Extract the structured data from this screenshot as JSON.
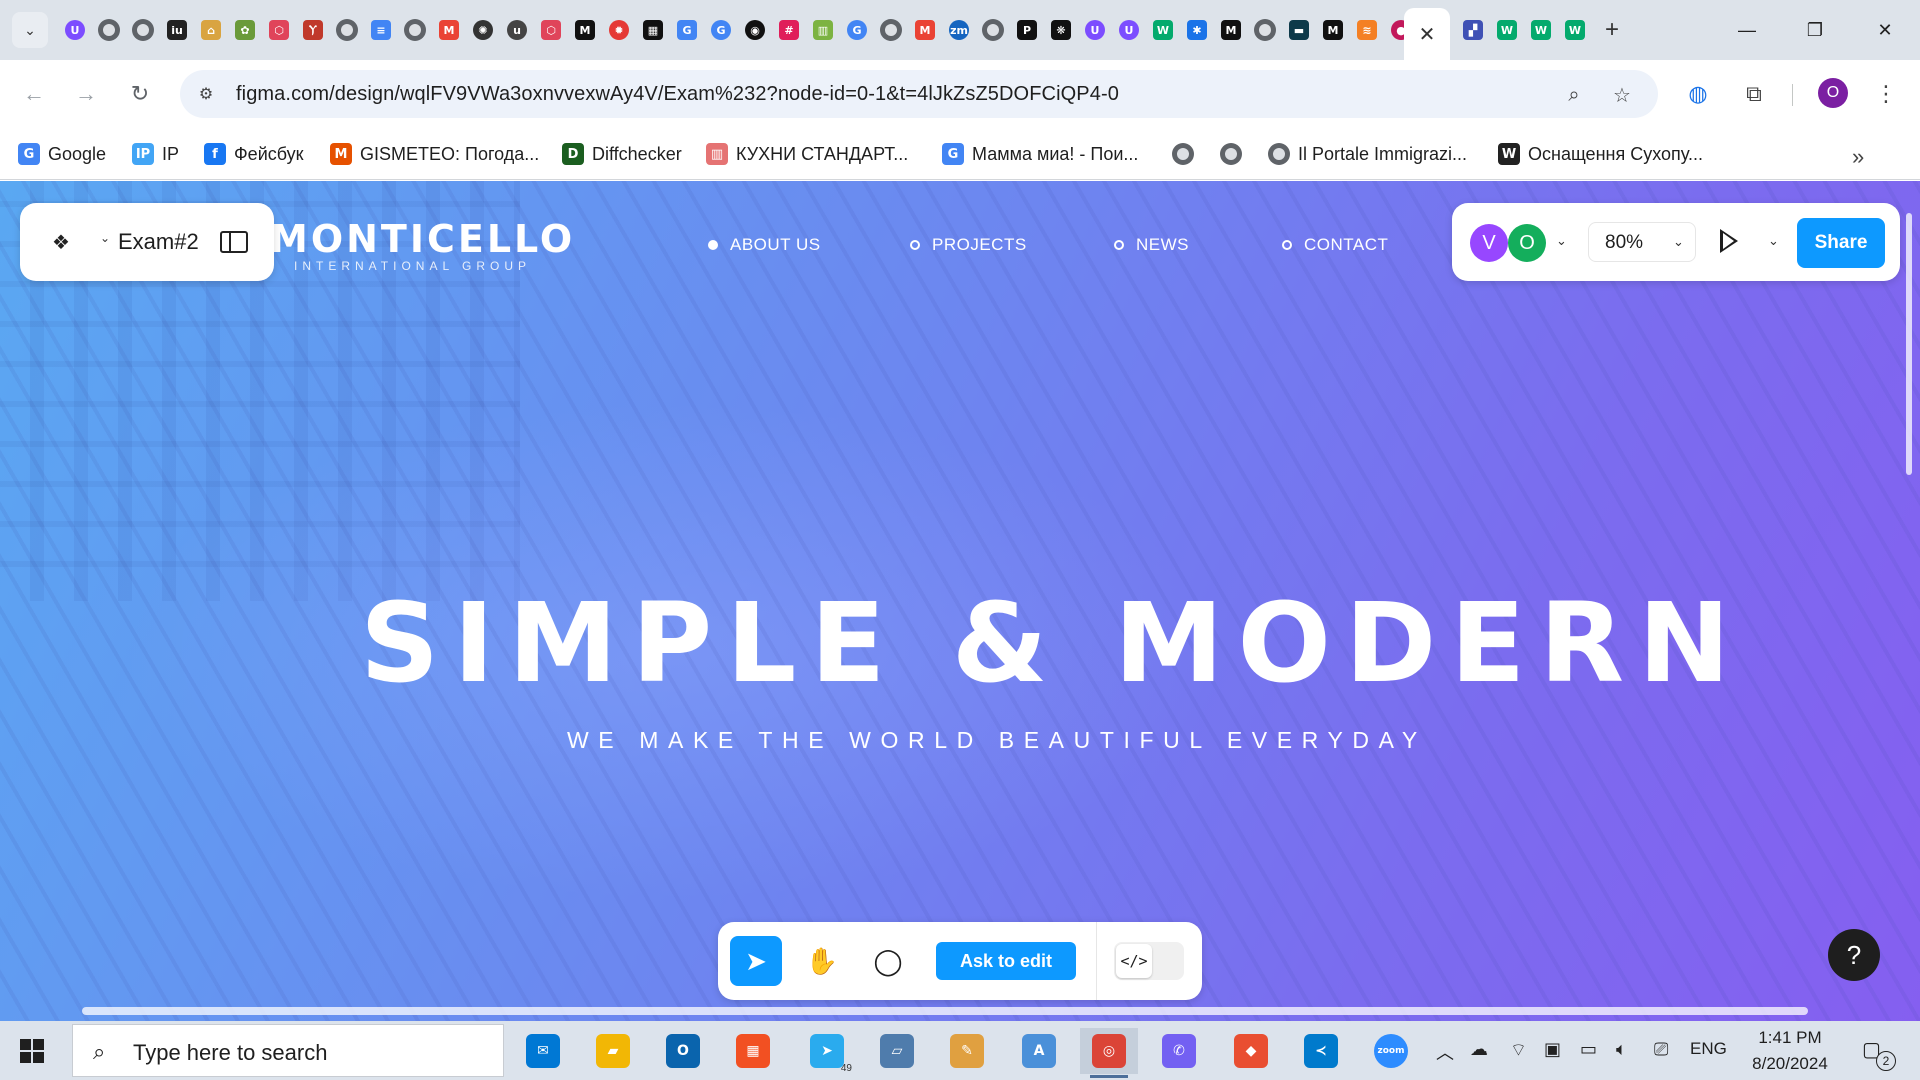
{
  "browser": {
    "tab_favicons": [
      {
        "name": "site-u-icon",
        "glyph": "U",
        "color": "#7c4dff",
        "round": true
      },
      {
        "name": "globe-icon",
        "glyph": "",
        "color": "#5f6368",
        "round": true
      },
      {
        "name": "globe-icon",
        "glyph": "",
        "color": "#5f6368",
        "round": true
      },
      {
        "name": "iu-icon",
        "glyph": "iu",
        "color": "#222222",
        "round": false
      },
      {
        "name": "home-icon",
        "glyph": "⌂",
        "color": "#d9a441",
        "round": false
      },
      {
        "name": "plant-icon",
        "glyph": "✿",
        "color": "#6a9a3a",
        "round": false
      },
      {
        "name": "hex-icon",
        "glyph": "⬡",
        "color": "#e0445a",
        "round": false
      },
      {
        "name": "figure-icon",
        "glyph": "Ⲩ",
        "color": "#c0392b",
        "round": false
      },
      {
        "name": "globe-icon",
        "glyph": "",
        "color": "#5f6368",
        "round": true
      },
      {
        "name": "docs-icon",
        "glyph": "≡",
        "color": "#4285f4",
        "round": false
      },
      {
        "name": "globe-icon",
        "glyph": "",
        "color": "#5f6368",
        "round": true
      },
      {
        "name": "gmail-icon",
        "glyph": "M",
        "color": "#ea4335",
        "round": false
      },
      {
        "name": "openai-icon",
        "glyph": "✺",
        "color": "#333333",
        "round": true
      },
      {
        "name": "u-icon",
        "glyph": "u",
        "color": "#444444",
        "round": true
      },
      {
        "name": "hex-icon",
        "glyph": "⬡",
        "color": "#e0445a",
        "round": false
      },
      {
        "name": "m-icon",
        "glyph": "M",
        "color": "#111111",
        "round": false
      },
      {
        "name": "gear-red-icon",
        "glyph": "✹",
        "color": "#e53935",
        "round": true
      },
      {
        "name": "puzzle-icon",
        "glyph": "▦",
        "color": "#111111",
        "round": false
      },
      {
        "name": "translate-icon",
        "glyph": "G",
        "color": "#4285f4",
        "round": false
      },
      {
        "name": "google-icon",
        "glyph": "G",
        "color": "#4285f4",
        "round": true
      },
      {
        "name": "github-icon",
        "glyph": "◉",
        "color": "#111111",
        "round": true
      },
      {
        "name": "slack-icon",
        "glyph": "#",
        "color": "#e01e5a",
        "round": false
      },
      {
        "name": "chart-icon",
        "glyph": "▥",
        "color": "#7cb342",
        "round": false
      },
      {
        "name": "google-icon",
        "glyph": "G",
        "color": "#4285f4",
        "round": true
      },
      {
        "name": "globe-icon",
        "glyph": "",
        "color": "#5f6368",
        "round": true
      },
      {
        "name": "gmail-icon",
        "glyph": "M",
        "color": "#ea4335",
        "round": false
      },
      {
        "name": "zm-icon",
        "glyph": "zm",
        "color": "#1565c0",
        "round": true
      },
      {
        "name": "globe-icon",
        "glyph": "",
        "color": "#5f6368",
        "round": true
      },
      {
        "name": "p-icon",
        "glyph": "P",
        "color": "#111111",
        "round": false
      },
      {
        "name": "paw-icon",
        "glyph": "❋",
        "color": "#111111",
        "round": false
      },
      {
        "name": "site-u-icon",
        "glyph": "U",
        "color": "#7c4dff",
        "round": true
      },
      {
        "name": "site-u-icon",
        "glyph": "U",
        "color": "#7c4dff",
        "round": true
      },
      {
        "name": "w3-icon",
        "glyph": "W",
        "color": "#04aa6d",
        "round": false
      },
      {
        "name": "gear-icon",
        "glyph": "✱",
        "color": "#1a73e8",
        "round": false
      },
      {
        "name": "m-icon",
        "glyph": "M",
        "color": "#111111",
        "round": false
      },
      {
        "name": "globe-icon",
        "glyph": "",
        "color": "#5f6368",
        "round": true
      },
      {
        "name": "dash-icon",
        "glyph": "▬",
        "color": "#0e3a4a",
        "round": false
      },
      {
        "name": "m-icon",
        "glyph": "M",
        "color": "#111111",
        "round": false
      },
      {
        "name": "stack-icon",
        "glyph": "≋",
        "color": "#f48024",
        "round": false
      },
      {
        "name": "apple-icon",
        "glyph": "●",
        "color": "#c2185b",
        "round": true
      }
    ],
    "active_tab_close": "✕",
    "tab_favicons_after": [
      {
        "name": "mosaic-icon",
        "glyph": "▞",
        "color": "#3f51b5",
        "round": false
      },
      {
        "name": "w3-icon",
        "glyph": "W",
        "color": "#04aa6d",
        "round": false
      },
      {
        "name": "w3-icon",
        "glyph": "W",
        "color": "#04aa6d",
        "round": false
      },
      {
        "name": "w3-icon",
        "glyph": "W",
        "color": "#04aa6d",
        "round": false
      }
    ],
    "new_tab": "+",
    "url": "figma.com/design/wqlFV9VWa3oxnvvexwAy4V/Exam%232?node-id=0-1&t=4lJkZsZ5DOFCiQP4-0",
    "profile_initial": "O",
    "bookmarks": [
      {
        "label": "Google",
        "icon": "google-icon",
        "glyph": "G",
        "color": "#4285f4"
      },
      {
        "label": "IP",
        "icon": "ip-icon",
        "glyph": "IP",
        "color": "#42a5f5"
      },
      {
        "label": "Фейсбук",
        "icon": "facebook-icon",
        "glyph": "f",
        "color": "#1877f2"
      },
      {
        "label": "GISMETEO: Погода...",
        "icon": "gismeteo-icon",
        "glyph": "M",
        "color": "#e65100"
      },
      {
        "label": "Diffchecker",
        "icon": "diffchecker-icon",
        "glyph": "D",
        "color": "#1b5e20"
      },
      {
        "label": "КУХНИ СТАНДАРТ...",
        "icon": "kitchen-icon",
        "glyph": "▥",
        "color": "#e57373"
      },
      {
        "label": "Мамма миа! - Пои...",
        "icon": "google-icon",
        "glyph": "G",
        "color": "#4285f4"
      },
      {
        "label": "",
        "icon": "globe-icon"
      },
      {
        "label": "",
        "icon": "globe-icon"
      },
      {
        "label": "Il Portale Immigrazi...",
        "icon": "globe-icon"
      },
      {
        "label": "Оснащення Сухопу...",
        "icon": "wikipedia-icon",
        "glyph": "W",
        "color": "#222222"
      }
    ]
  },
  "figma": {
    "file_name": "Exam#2",
    "collaborators": [
      {
        "initial": "V",
        "color": "#9747ff"
      },
      {
        "initial": "O",
        "color": "#14ae5c"
      }
    ],
    "zoom": "80%",
    "share_label": "Share",
    "ask_to_edit_label": "Ask to edit",
    "dev_mode_glyph": "</>",
    "help_glyph": "?"
  },
  "site": {
    "logo_main": "MONTICELLO",
    "logo_sub": "INTERNATIONAL GROUP",
    "nav": [
      {
        "label": "ABOUT US",
        "active": true
      },
      {
        "label": "PROJECTS",
        "active": false
      },
      {
        "label": "NEWS",
        "active": false
      },
      {
        "label": "CONTACT",
        "active": false
      }
    ],
    "hero_title": "SIMPLE & MODERN",
    "hero_subtitle": "WE MAKE THE WORLD BEAUTIFUL EVERYDAY"
  },
  "taskbar": {
    "search_placeholder": "Type here to search",
    "apps": [
      {
        "name": "mail-app-icon",
        "glyph": "✉",
        "color": "#0078d4",
        "active": false
      },
      {
        "name": "file-explorer-icon",
        "glyph": "▰",
        "color": "#f2b705",
        "active": false
      },
      {
        "name": "outlook-icon",
        "glyph": "O",
        "color": "#0a64ad",
        "active": false
      },
      {
        "name": "store-icon",
        "glyph": "▦",
        "color": "#f25022",
        "active": false
      },
      {
        "name": "telegram-icon",
        "glyph": "➤",
        "color": "#2aabee",
        "active": false,
        "badge": "49"
      },
      {
        "name": "notes-app-icon",
        "glyph": "▱",
        "color": "#4f7cac",
        "active": false
      },
      {
        "name": "paint-icon",
        "glyph": "✎",
        "color": "#e0a040",
        "active": false
      },
      {
        "name": "document-app-icon",
        "glyph": "A",
        "color": "#4a90d9",
        "active": false
      },
      {
        "name": "chrome-icon",
        "glyph": "◎",
        "color": "#db4437",
        "active": true
      },
      {
        "name": "viber-icon",
        "glyph": "✆",
        "color": "#7360f2",
        "active": false
      },
      {
        "name": "git-app-icon",
        "glyph": "◆",
        "color": "#e94e31",
        "active": false
      },
      {
        "name": "vscode-icon",
        "glyph": "≺",
        "color": "#007acc",
        "active": false
      },
      {
        "name": "zoom-icon",
        "glyph": "zoom",
        "color": "#2d8cff",
        "active": false
      }
    ],
    "language": "ENG",
    "time": "1:41 PM",
    "date": "8/20/2024",
    "notification_count": "2"
  }
}
